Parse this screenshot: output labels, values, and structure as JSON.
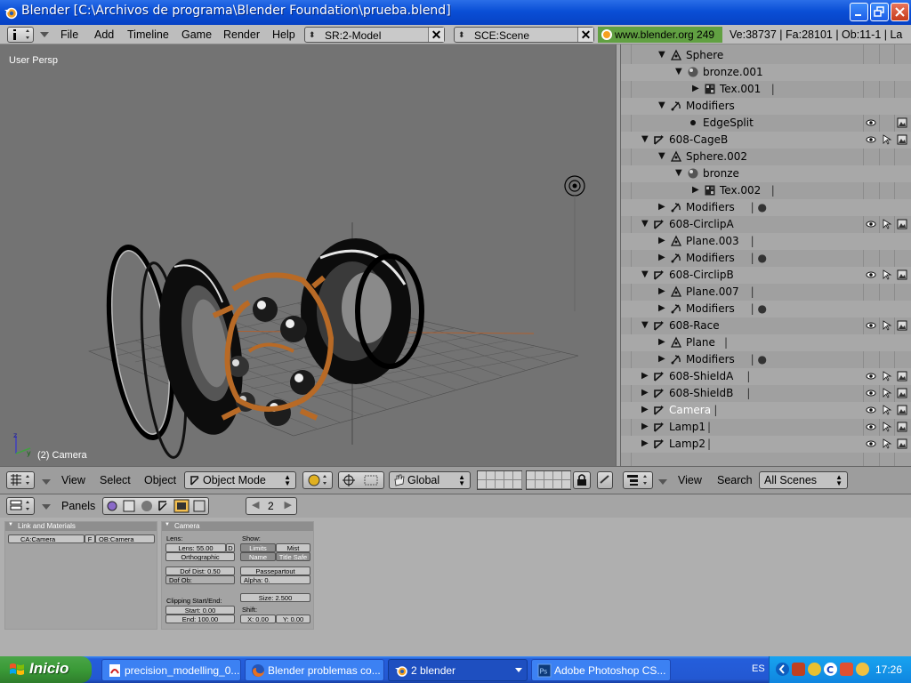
{
  "window": {
    "title": "Blender [C:\\Archivos de programa\\Blender Foundation\\prueba.blend]"
  },
  "info_header": {
    "menus": [
      "File",
      "Add",
      "Timeline",
      "Game",
      "Render",
      "Help"
    ],
    "screen_field": "SR:2-Model",
    "scene_field": "SCE:Scene",
    "website": "www.blender.org 249",
    "stats": "Ve:38737 | Fa:28101 | Ob:11-1 | La"
  },
  "viewport": {
    "view_label": "User Persp",
    "object_label": "(2) Camera"
  },
  "outliner": {
    "rows": [
      {
        "indent": 2,
        "tri": "▼",
        "icon": "mesh-data-icon",
        "label": "Sphere",
        "extra": ""
      },
      {
        "indent": 3,
        "tri": "▼",
        "icon": "material-icon",
        "label": "bronze.001",
        "extra": ""
      },
      {
        "indent": 4,
        "tri": "▶",
        "icon": "texture-icon",
        "label": "Tex.001",
        "extra": "|"
      },
      {
        "indent": 2,
        "tri": "▼",
        "icon": "modifier-icon",
        "label": "Modifiers",
        "extra": ""
      },
      {
        "indent": 3,
        "tri": "",
        "icon": "dot-icon",
        "label": "EdgeSplit",
        "extra": "",
        "eye": true,
        "ren": true
      },
      {
        "indent": 1,
        "tri": "▼",
        "icon": "empty-axis-icon",
        "label": "608-CageB",
        "extra": "",
        "eye": true,
        "cur": true,
        "ren": true
      },
      {
        "indent": 2,
        "tri": "▼",
        "icon": "mesh-data-icon",
        "label": "Sphere.002",
        "extra": ""
      },
      {
        "indent": 3,
        "tri": "▼",
        "icon": "material-icon",
        "label": "bronze",
        "extra": ""
      },
      {
        "indent": 4,
        "tri": "▶",
        "icon": "texture-icon",
        "label": "Tex.002",
        "extra": "|"
      },
      {
        "indent": 2,
        "tri": "▶",
        "icon": "modifier-icon",
        "label": "Modifiers",
        "extra": "|  ●"
      },
      {
        "indent": 1,
        "tri": "▼",
        "icon": "empty-axis-icon",
        "label": "608-CirclipA",
        "extra": "",
        "eye": true,
        "cur": true,
        "ren": true
      },
      {
        "indent": 2,
        "tri": "▶",
        "icon": "mesh-data-icon",
        "label": "Plane.003",
        "extra": "|"
      },
      {
        "indent": 2,
        "tri": "▶",
        "icon": "modifier-icon",
        "label": "Modifiers",
        "extra": "|  ●"
      },
      {
        "indent": 1,
        "tri": "▼",
        "icon": "empty-axis-icon",
        "label": "608-CirclipB",
        "extra": "",
        "eye": true,
        "cur": true,
        "ren": true
      },
      {
        "indent": 2,
        "tri": "▶",
        "icon": "mesh-data-icon",
        "label": "Plane.007",
        "extra": "|"
      },
      {
        "indent": 2,
        "tri": "▶",
        "icon": "modifier-icon",
        "label": "Modifiers",
        "extra": "|  ●"
      },
      {
        "indent": 1,
        "tri": "▼",
        "icon": "empty-axis-icon",
        "label": "608-Race",
        "extra": "",
        "eye": true,
        "cur": true,
        "ren": true
      },
      {
        "indent": 2,
        "tri": "▶",
        "icon": "mesh-data-icon",
        "label": "Plane",
        "extra": "|"
      },
      {
        "indent": 2,
        "tri": "▶",
        "icon": "modifier-icon",
        "label": "Modifiers",
        "extra": "|  ●"
      },
      {
        "indent": 1,
        "tri": "▶",
        "icon": "empty-axis-icon",
        "label": "608-ShieldA",
        "extra": "|",
        "eye": true,
        "cur": true,
        "ren": true
      },
      {
        "indent": 1,
        "tri": "▶",
        "icon": "empty-axis-icon",
        "label": "608-ShieldB",
        "extra": "|",
        "eye": true,
        "cur": true,
        "ren": true
      },
      {
        "indent": 1,
        "tri": "▶",
        "icon": "empty-axis-icon",
        "label": "Camera",
        "extra": "|",
        "eye": true,
        "cur": true,
        "ren": true,
        "selected": true
      },
      {
        "indent": 1,
        "tri": "▶",
        "icon": "empty-axis-icon",
        "label": "Lamp1",
        "extra": "|",
        "eye": true,
        "cur": true,
        "ren": true
      },
      {
        "indent": 1,
        "tri": "▶",
        "icon": "empty-axis-icon",
        "label": "Lamp2",
        "extra": "|",
        "eye": true,
        "cur": true,
        "ren": true
      }
    ]
  },
  "viewport_header": {
    "menus": [
      "View",
      "Select",
      "Object"
    ],
    "mode": "Object Mode",
    "orientation": "Global"
  },
  "outliner_header": {
    "menus": [
      "View",
      "Search"
    ],
    "filter": "All Scenes"
  },
  "buttons_header": {
    "label": "Panels",
    "frame": "2"
  },
  "panels": {
    "link": {
      "title": "Link and Materials",
      "camera_field": "CA:Camera",
      "f_label": "F",
      "ob_field": "OB:Camera"
    },
    "camera": {
      "title": "Camera",
      "lens_label": "Lens:",
      "lens_value": "Lens: 55.00",
      "lens_d": "D",
      "ortho": "Orthographic",
      "dof_dist": "Dof Dist: 0.50",
      "dof_ob": "Dof Ob:",
      "clipping_label": "Clipping Start/End:",
      "clip_start": "Start: 0.00",
      "clip_end": "End: 100.00",
      "show_label": "Show:",
      "limits": "Limits",
      "mist": "Mist",
      "name": "Name",
      "title_safe": "Title Safe",
      "passepartout": "Passepartout",
      "alpha": "Alpha: 0.",
      "size": "Size: 2.500",
      "shift_label": "Shift:",
      "shift_x": "X: 0.00",
      "shift_y": "Y: 0.00"
    }
  },
  "taskbar": {
    "start": "Inicio",
    "tasks": [
      {
        "label": "precision_modelling_0...",
        "icon": "pdf-icon"
      },
      {
        "label": "Blender problemas co...",
        "icon": "firefox-icon"
      },
      {
        "label": "2 blender",
        "icon": "blender-icon"
      },
      {
        "label": "Adobe Photoshop CS...",
        "icon": "photoshop-icon"
      }
    ],
    "language": "ES",
    "clock": "17:26"
  }
}
